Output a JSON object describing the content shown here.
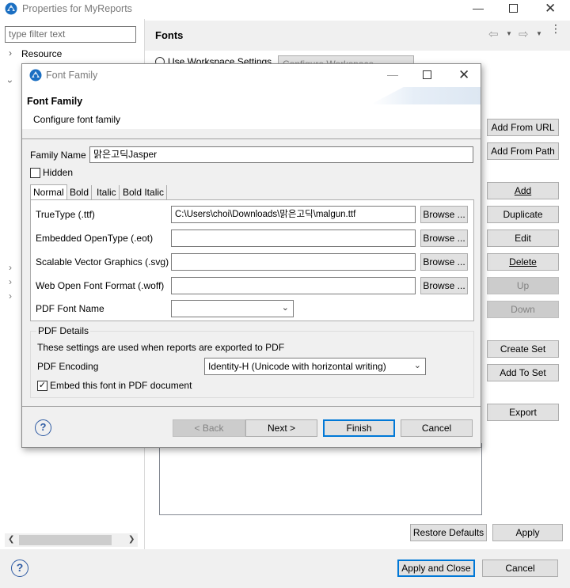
{
  "main": {
    "title": "Properties for MyReports",
    "filter_placeholder": "type filter text",
    "tree_item_resource": "Resource",
    "section_title": "Fonts",
    "use_workspace_settings": "Use Workspace Settings",
    "configure_workspace_settings": "Configure Workspace Settings...",
    "side_buttons": {
      "add_from_url": "Add From URL",
      "add_from_path": "Add From Path",
      "add": "Add",
      "duplicate": "Duplicate",
      "edit": "Edit",
      "delete": "Delete",
      "up": "Up",
      "down": "Down",
      "create_set": "Create Set",
      "add_to_set": "Add To Set",
      "export": "Export"
    },
    "restore_defaults": "Restore Defaults",
    "apply": "Apply",
    "apply_and_close": "Apply and Close",
    "cancel": "Cancel"
  },
  "dialog": {
    "title": "Font Family",
    "heading": "Font Family",
    "subheading": "Configure font family",
    "family_name_label": "Family Name",
    "family_name_value": "맑은고딕Jasper",
    "hidden_label": "Hidden",
    "tabs": [
      "Normal",
      "Bold",
      "Italic",
      "Bold Italic"
    ],
    "rows": [
      {
        "label": "TrueType (.ttf)",
        "value": "C:\\Users\\choi\\Downloads\\맑은고딕\\malgun.ttf",
        "browse": "Browse ..."
      },
      {
        "label": "Embedded OpenType (.eot)",
        "value": "",
        "browse": "Browse ..."
      },
      {
        "label": "Scalable Vector Graphics (.svg)",
        "value": "",
        "browse": "Browse ..."
      },
      {
        "label": "Web Open Font Format (.woff)",
        "value": "",
        "browse": "Browse ..."
      }
    ],
    "pdf_font_name_label": "PDF Font Name",
    "pdf_font_name_value": "",
    "pdf_details_title": "PDF Details",
    "pdf_details_desc": "These settings are used when reports are exported to PDF",
    "pdf_encoding_label": "PDF Encoding",
    "pdf_encoding_value": "Identity-H (Unicode with horizontal writing)",
    "embed_label": "Embed this font in PDF document",
    "back": "< Back",
    "next": "Next >",
    "finish": "Finish",
    "cancel": "Cancel"
  }
}
